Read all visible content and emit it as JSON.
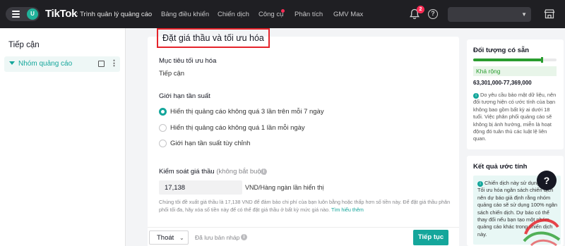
{
  "topbar": {
    "brand": "TikTok",
    "brand_sub": ": Trình quản lý quảng cáo",
    "avatar_letter": "U",
    "nav": [
      "Bảng điều khiển",
      "Chiến dịch",
      "Công cụ",
      "Phân tích",
      "GMV Max"
    ],
    "notification_count": "2",
    "accent_color": "#14a69b"
  },
  "sidebar": {
    "title": "Tiếp cận",
    "item_label": "Nhóm quảng cáo"
  },
  "main": {
    "section_title": "Đặt giá thầu và tối ưu hóa",
    "goal_label": "Mục tiêu tối ưu hóa",
    "goal_value": "Tiếp cận",
    "freq_label": "Giới hạn tần suất",
    "freq_options": [
      "Hiển thị quảng cáo không quá 3 lần trên mỗi 7 ngày",
      "Hiển thị quảng cáo không quá 1 lần mỗi ngày",
      "Giới hạn tần suất tùy chỉnh"
    ],
    "freq_selected_index": 0,
    "bid_label": "Kiểm soát giá thầu",
    "bid_optional": "(không bắt buộc)",
    "bid_value": "17,138",
    "bid_unit": "VND/Hàng ngàn lần hiển thị",
    "bid_hint": "Chúng tôi đề xuất giá thầu là 17,138 VND để đảm bảo chi phí của bạn luôn bằng hoặc thấp hơn số tiền này. Để đặt giá thầu phân phối tối đa, hãy xóa số tiền này để có thể đặt giá thầu ở bất kỳ mức giá nào.",
    "bid_hint_link": "Tìm hiểu thêm"
  },
  "footer": {
    "exit_label": "Thoát",
    "draft_label": "Đã lưu bản nháp",
    "continue_label": "Tiếp tục"
  },
  "audience_panel": {
    "title": "Đối tượng có sẵn",
    "meter_level": 0.82,
    "reach_label": "Khá rộng",
    "reach_range": "63,301,000-77,369,000",
    "note": "Do yêu cầu bảo mật dữ liệu, nên đối tượng hiện có ước tính của bạn không bao gồm bất kỳ ai dưới 18 tuổi. Việc phân phối quảng cáo sẽ không bị ảnh hưởng, miễn là hoạt động đó tuân thủ các luật lệ liên quan."
  },
  "estimate_panel": {
    "title": "Kết quả ước tính",
    "note": "Chiến dịch này sử dụng năng Tối ưu hóa ngân sách chiến dịch nên dự báo giả định rằng nhóm quảng cáo sẽ sử dụng 100% ngân sách chiến dịch. Dự báo có thể thay đổi nếu bạn tạo một nhóm quảng cáo khác trong chiến dịch này."
  }
}
